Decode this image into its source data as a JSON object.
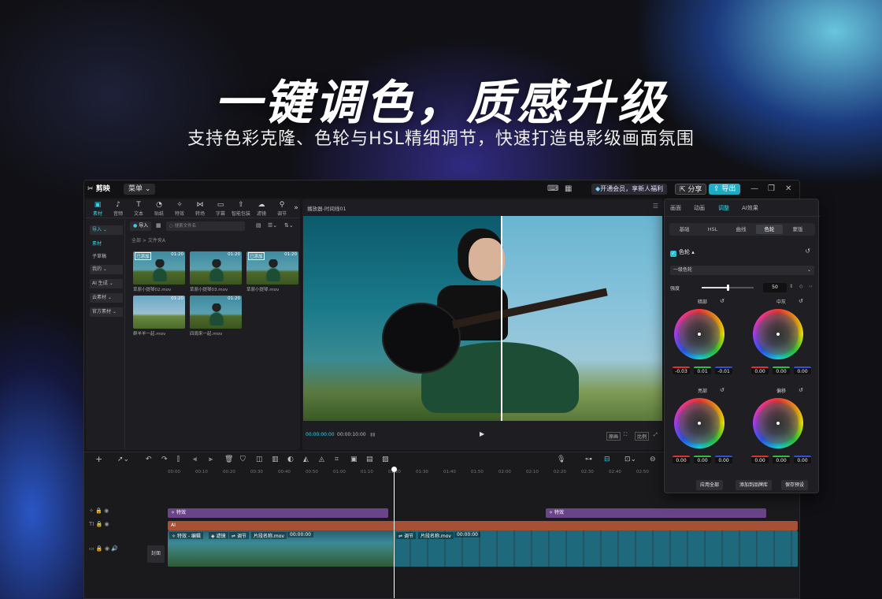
{
  "hero": {
    "headline": "一键调色，质感升级",
    "subline": "支持色彩克隆、色轮与HSL精细调节，快速打造电影级画面氛围"
  },
  "titlebar": {
    "logo": "剪映",
    "menu": "菜单",
    "vip": "开通会员，享新人福利",
    "share": "分享",
    "export": "导出"
  },
  "media_tools": [
    "素材",
    "音频",
    "文本",
    "贴纸",
    "特效",
    "转场",
    "字幕",
    "智能包装",
    "滤镜",
    "调节"
  ],
  "sidebar": [
    "导入",
    "素材",
    "子草稿",
    "我的",
    "AI 生成",
    "云素材",
    "官方素材"
  ],
  "media": {
    "import_label": "导入",
    "search_placeholder": "搜索文件名",
    "crumb": "全部 > 文件夹A",
    "items": [
      {
        "name": "草原小提琴02.mov",
        "duration": "01:20",
        "tag": "已添加"
      },
      {
        "name": "草原小提琴03.mov",
        "duration": "01:20",
        "tag": ""
      },
      {
        "name": "草原小提琴.mov",
        "duration": "01:20",
        "tag": "已添加"
      },
      {
        "name": "群羊羊一起.mov",
        "duration": "01:20",
        "tag": ""
      },
      {
        "name": "四周来一起.mov",
        "duration": "01:20",
        "tag": ""
      }
    ]
  },
  "player": {
    "title": "播放器-时间线01",
    "current_time": "00:00:00:00",
    "total_time": "00:00:10:00",
    "buttons": [
      "原画",
      "比例"
    ]
  },
  "adjust": {
    "tabs": [
      "画面",
      "动画",
      "调整",
      "AI效果"
    ],
    "subtabs": [
      "基础",
      "HSL",
      "曲线",
      "色轮",
      "蒙版"
    ],
    "section": "色轮",
    "mode": "一级色轮",
    "intensity_label": "强度",
    "intensity_value": "50",
    "intensity_fraction": 0.5,
    "wheels": [
      {
        "name": "暗部",
        "values": [
          "-0.03",
          "0.01",
          "-0.01"
        ]
      },
      {
        "name": "中灰",
        "values": [
          "0.00",
          "0.00",
          "0.00"
        ]
      },
      {
        "name": "亮部",
        "values": [
          "0.00",
          "0.00",
          "0.00"
        ]
      },
      {
        "name": "偏移",
        "values": [
          "0.00",
          "0.00",
          "0.00"
        ]
      }
    ],
    "buttons": [
      "应用全部",
      "添加到品牌库",
      "保存预设"
    ]
  },
  "timeline": {
    "ruler": [
      "00:00",
      "00:10",
      "00:20",
      "00:30",
      "00:40",
      "00:50",
      "01:00",
      "01:10",
      "01:20",
      "01:30",
      "01:40",
      "01:50",
      "02:00",
      "02:10",
      "02:20",
      "02:30",
      "02:40",
      "02:50"
    ],
    "effect_clip": "特效",
    "effect_clip2": "特效",
    "ai_clip": "AI",
    "video_a_labels": [
      "特效 - 编辑",
      "滤镜",
      "调节",
      "片段名称.mov",
      "00:00:00"
    ],
    "video_b_labels": [
      "调节",
      "片段名称.mov",
      "00:00:00"
    ],
    "cover": "封面"
  },
  "colors": {
    "accent": "#34d0e6",
    "export": "#1fb0c8",
    "effect": "#7a4a9a",
    "ai": "#b85a40"
  }
}
